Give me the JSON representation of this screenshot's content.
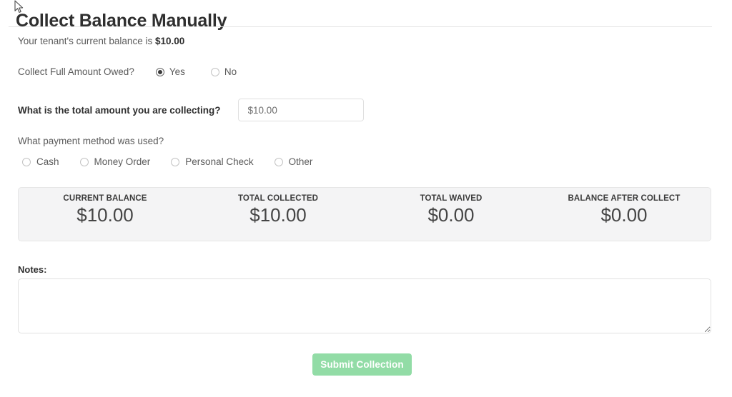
{
  "page": {
    "title": "Collect Balance Manually"
  },
  "balance_line": {
    "text": "Your tenant's current balance is ",
    "amount": "$10.00"
  },
  "full_amount": {
    "question": "Collect Full Amount Owed?",
    "options": [
      {
        "label": "Yes",
        "selected": true
      },
      {
        "label": "No",
        "selected": false
      }
    ]
  },
  "total_amount": {
    "question": "What is the total amount you are collecting?",
    "input_value": "",
    "input_placeholder": "$10.00"
  },
  "payment_method": {
    "question": "What payment method was used?",
    "options": [
      {
        "label": "Cash",
        "selected": false
      },
      {
        "label": "Money Order",
        "selected": false
      },
      {
        "label": "Personal Check",
        "selected": false
      },
      {
        "label": "Other",
        "selected": false
      }
    ]
  },
  "summary": {
    "columns": [
      {
        "head": "CURRENT BALANCE",
        "value": "$10.00"
      },
      {
        "head": "TOTAL COLLECTED",
        "value": "$10.00"
      },
      {
        "head": "TOTAL WAIVED",
        "value": "$0.00"
      },
      {
        "head": "BALANCE AFTER COLLECT",
        "value": "$0.00"
      }
    ]
  },
  "notes": {
    "label": "Notes:",
    "value": "",
    "placeholder": ""
  },
  "submit": {
    "label": "Submit Collection"
  },
  "colors": {
    "submit_green": "#92dca6",
    "panel_bg": "#f4f4f5",
    "border": "#e6e6e6",
    "text": "#5a5a5a",
    "heading": "#2f2f2f"
  }
}
